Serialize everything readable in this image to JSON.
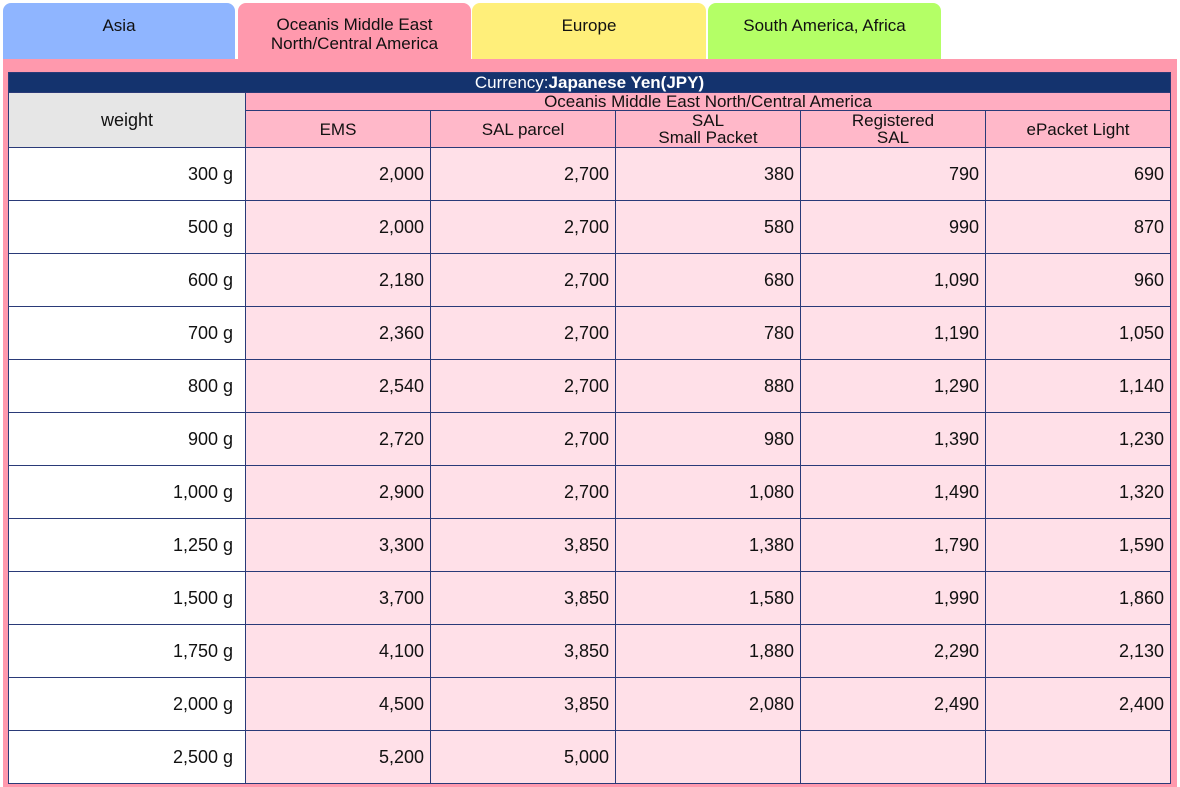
{
  "tabs": [
    {
      "id": "asia",
      "label": "Asia"
    },
    {
      "id": "oceania",
      "line1": "Oceanis Middle East",
      "line2": "North/Central America"
    },
    {
      "id": "europe",
      "label": "Europe"
    },
    {
      "id": "sa",
      "label": "South America, Africa"
    }
  ],
  "currency": {
    "prefix": "Currency:",
    "value": "Japanese Yen(JPY)"
  },
  "table": {
    "weight_header": "weight",
    "region": "Oceanis Middle East North/Central America",
    "columns": [
      {
        "l1": "EMS",
        "l2": ""
      },
      {
        "l1": "SAL parcel",
        "l2": ""
      },
      {
        "l1": "SAL",
        "l2": "Small Packet"
      },
      {
        "l1": "Registered",
        "l2": "SAL"
      },
      {
        "l1": "ePacket Light",
        "l2": ""
      }
    ],
    "rows": [
      {
        "w": "300 g",
        "v": [
          "2,000",
          "2,700",
          "380",
          "790",
          "690"
        ]
      },
      {
        "w": "500 g",
        "v": [
          "2,000",
          "2,700",
          "580",
          "990",
          "870"
        ]
      },
      {
        "w": "600 g",
        "v": [
          "2,180",
          "2,700",
          "680",
          "1,090",
          "960"
        ]
      },
      {
        "w": "700 g",
        "v": [
          "2,360",
          "2,700",
          "780",
          "1,190",
          "1,050"
        ]
      },
      {
        "w": "800 g",
        "v": [
          "2,540",
          "2,700",
          "880",
          "1,290",
          "1,140"
        ]
      },
      {
        "w": "900 g",
        "v": [
          "2,720",
          "2,700",
          "980",
          "1,390",
          "1,230"
        ]
      },
      {
        "w": "1,000 g",
        "v": [
          "2,900",
          "2,700",
          "1,080",
          "1,490",
          "1,320"
        ]
      },
      {
        "w": "1,250 g",
        "v": [
          "3,300",
          "3,850",
          "1,380",
          "1,790",
          "1,590"
        ]
      },
      {
        "w": "1,500 g",
        "v": [
          "3,700",
          "3,850",
          "1,580",
          "1,990",
          "1,860"
        ]
      },
      {
        "w": "1,750 g",
        "v": [
          "4,100",
          "3,850",
          "1,880",
          "2,290",
          "2,130"
        ]
      },
      {
        "w": "2,000 g",
        "v": [
          "4,500",
          "3,850",
          "2,080",
          "2,490",
          "2,400"
        ]
      },
      {
        "w": "2,500 g",
        "v": [
          "5,200",
          "5,000",
          "",
          "",
          ""
        ]
      }
    ]
  }
}
